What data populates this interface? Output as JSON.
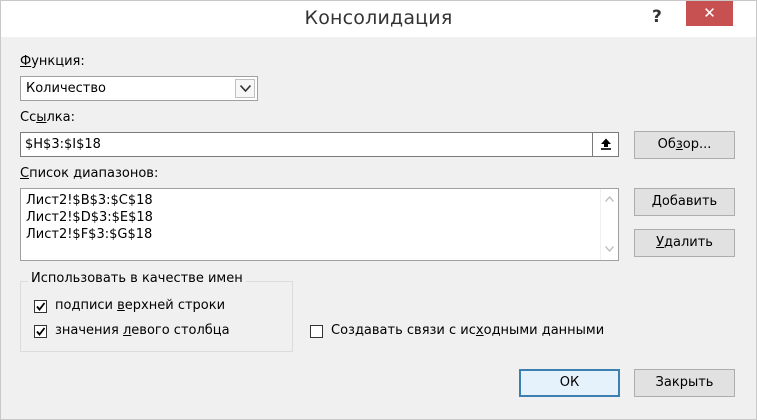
{
  "title": "Консолидация",
  "help_label": "?",
  "close_label": "✕",
  "function": {
    "label_u": "Ф",
    "label_rest": "ункция:",
    "value": "Количество"
  },
  "reference": {
    "label_pre": "Сс",
    "label_u": "ы",
    "label_post": "лка:",
    "value": "$H$3:$I$18",
    "browse_pre": "Об",
    "browse_u": "з",
    "browse_post": "ор..."
  },
  "ranges": {
    "label_u": "С",
    "label_rest": "писок диапазонов:",
    "items": [
      "Лист2!$B$3:$C$18",
      "Лист2!$D$3:$E$18",
      "Лист2!$F$3:$G$18"
    ],
    "add_pre": "",
    "add_u": "Д",
    "add_post": "обавить",
    "delete_u": "У",
    "delete_post": "далить"
  },
  "names_group": {
    "title": "Использовать в качестве имен",
    "top_row_pre": "подписи ",
    "top_row_u": "в",
    "top_row_post": "ерхней строки",
    "top_row_checked": true,
    "left_col_pre": "значения ",
    "left_col_u": "л",
    "left_col_post": "евого столбца",
    "left_col_checked": true
  },
  "links": {
    "pre": "Создавать связи с ис",
    "u": "х",
    "post": "одными данными",
    "checked": false
  },
  "ok_label": "ОК",
  "close_button_label": "Закрыть"
}
